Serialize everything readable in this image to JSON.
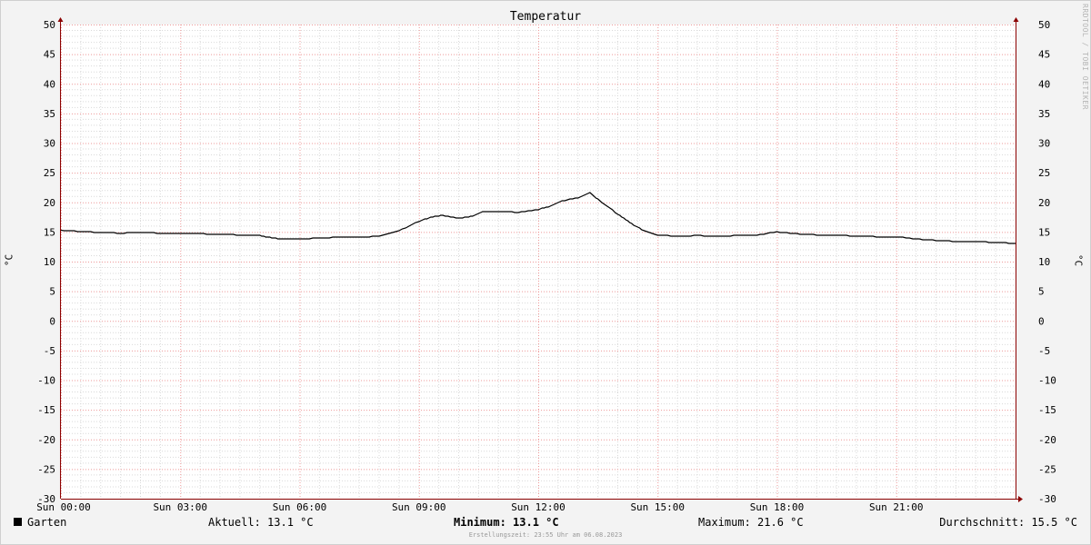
{
  "watermark": "RRDTOOL / TOBI OETIKER",
  "chart_data": {
    "type": "line",
    "title": "Temperatur",
    "ylabel": "°C",
    "ylabel_right": "°C",
    "ylim": [
      -30,
      50
    ],
    "yticks": [
      50,
      45,
      40,
      35,
      30,
      25,
      20,
      15,
      10,
      5,
      0,
      -5,
      -10,
      -15,
      -20,
      -25,
      -30
    ],
    "ytick_labels": [
      "50",
      "45",
      "40",
      "35",
      "30",
      "25",
      "20",
      "15",
      "10",
      "5",
      "0",
      "-5",
      "-10",
      "-15",
      "-20",
      "-25",
      "-30"
    ],
    "xlim": [
      0,
      24
    ],
    "xticks": [
      0,
      3,
      6,
      9,
      12,
      15,
      18,
      21
    ],
    "xtick_labels": [
      "Sun 00:00",
      "Sun 03:00",
      "Sun 06:00",
      "Sun 09:00",
      "Sun 12:00",
      "Sun 15:00",
      "Sun 18:00",
      "Sun 21:00"
    ],
    "grid": true,
    "legend_position": "bottom-left",
    "colors": {
      "line": "#000000",
      "major_grid": "#ee9999",
      "minor_grid": "#d9d9d9",
      "axis": "#8b0000",
      "plot_bg": "#ffffff"
    },
    "series": [
      {
        "name": "Garten",
        "x": [
          0,
          0.5,
          1,
          1.5,
          2,
          2.5,
          3,
          3.5,
          4,
          4.5,
          5,
          5.3,
          5.6,
          6,
          6.5,
          7,
          7.5,
          8,
          8.5,
          9,
          9.3,
          9.6,
          10,
          10.3,
          10.6,
          11,
          11.5,
          12,
          12.3,
          12.6,
          13,
          13.3,
          13.6,
          14,
          14.3,
          14.6,
          15,
          15.5,
          16,
          16.5,
          17,
          17.5,
          18,
          18.5,
          19,
          19.5,
          20,
          20.5,
          21,
          21.5,
          22,
          22.5,
          23,
          23.5,
          24
        ],
        "y": [
          15.3,
          15.1,
          14.9,
          14.8,
          14.9,
          14.8,
          14.8,
          14.7,
          14.6,
          14.5,
          14.4,
          14.0,
          13.8,
          13.8,
          14.0,
          14.1,
          14.1,
          14.3,
          15.2,
          16.8,
          17.5,
          17.8,
          17.3,
          17.6,
          18.4,
          18.5,
          18.3,
          18.8,
          19.3,
          20.2,
          20.8,
          21.6,
          20.0,
          18.0,
          16.6,
          15.4,
          14.5,
          14.3,
          14.4,
          14.3,
          14.4,
          14.5,
          15.0,
          14.7,
          14.5,
          14.5,
          14.3,
          14.2,
          14.2,
          13.8,
          13.6,
          13.4,
          13.4,
          13.2,
          13.1
        ]
      }
    ]
  },
  "legend": {
    "series_name": "Garten",
    "current": "Aktuell: 13.1 °C",
    "minimum": "Minimum: 13.1 °C",
    "maximum": "Maximum: 21.6 °C",
    "average": "Durchschnitt: 15.5 °C"
  },
  "footer": "Erstellungszeit: 23:55 Uhr am 06.08.2023"
}
